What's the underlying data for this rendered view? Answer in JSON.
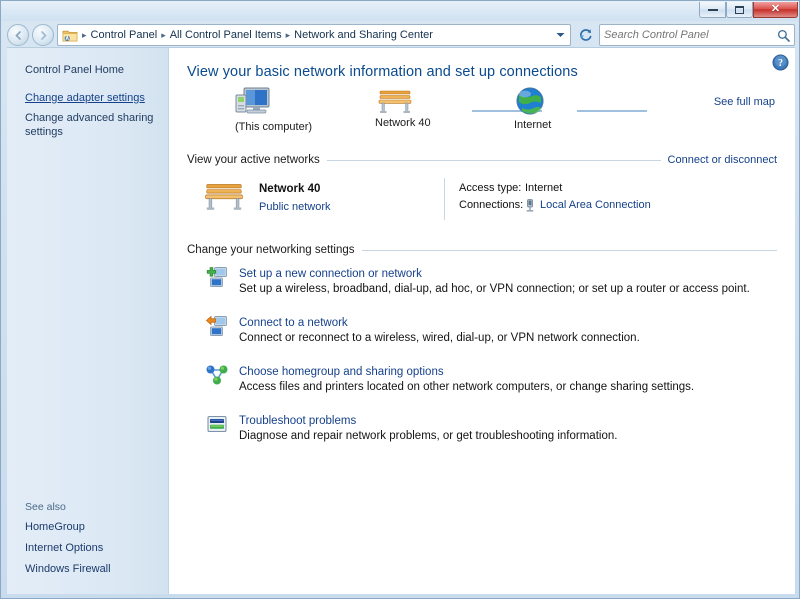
{
  "window": {
    "title": "Network and Sharing Center",
    "buttons": {
      "minimize": "Minimize",
      "maximize": "Maximize",
      "close": "Close"
    }
  },
  "toolbar": {
    "back_label": "Back",
    "forward_label": "Forward",
    "breadcrumbs": [
      "Control Panel",
      "All Control Panel Items",
      "Network and Sharing Center"
    ],
    "breadcrumb_separator": "▸",
    "dropdown_label": "Previous Locations",
    "refresh_label": "Refresh",
    "search": {
      "placeholder": "Search Control Panel",
      "value": ""
    }
  },
  "sidebar": {
    "items": [
      {
        "label": "Control Panel Home",
        "style": "plain"
      },
      {
        "label": "Change adapter settings",
        "style": "hovered"
      },
      {
        "label": "Change advanced sharing settings",
        "style": "plain"
      }
    ],
    "see_also": {
      "heading": "See also",
      "items": [
        "HomeGroup",
        "Internet Options",
        "Windows Firewall"
      ]
    }
  },
  "main": {
    "help_label": "Help",
    "page_title": "View your basic network information and set up connections",
    "map": {
      "see_full_map": "See full map",
      "nodes": [
        {
          "icon": "computer-icon",
          "label": "(This computer)"
        },
        {
          "icon": "bench-icon",
          "label": "Network  40"
        },
        {
          "icon": "globe-icon",
          "label": "Internet"
        }
      ]
    },
    "active_networks": {
      "heading": "View your active networks",
      "action_link": "Connect or disconnect",
      "network": {
        "icon": "bench-icon",
        "name": "Network  40",
        "type": "Public network",
        "details": [
          {
            "key": "Access type:",
            "value": "Internet",
            "link": false,
            "icon": null
          },
          {
            "key": "Connections:",
            "value": "Local Area Connection",
            "link": true,
            "icon": "network-adapter-icon"
          }
        ]
      }
    },
    "settings": {
      "heading": "Change your networking settings",
      "items": [
        {
          "icon": "new-connection-icon",
          "title": "Set up a new connection or network",
          "desc": "Set up a wireless, broadband, dial-up, ad hoc, or VPN connection; or set up a router or access point."
        },
        {
          "icon": "connect-network-icon",
          "title": "Connect to a network",
          "desc": "Connect or reconnect to a wireless, wired, dial-up, or VPN network connection."
        },
        {
          "icon": "homegroup-icon",
          "title": "Choose homegroup and sharing options",
          "desc": "Access files and printers located on other network computers, or change sharing settings."
        },
        {
          "icon": "troubleshoot-icon",
          "title": "Troubleshoot problems",
          "desc": "Diagnose and repair network problems, or get troubleshooting information."
        }
      ]
    }
  },
  "colors": {
    "link": "#15418a",
    "title": "#0a4a8f",
    "frame": "#c9dcee",
    "close_button": "#c6302c"
  }
}
